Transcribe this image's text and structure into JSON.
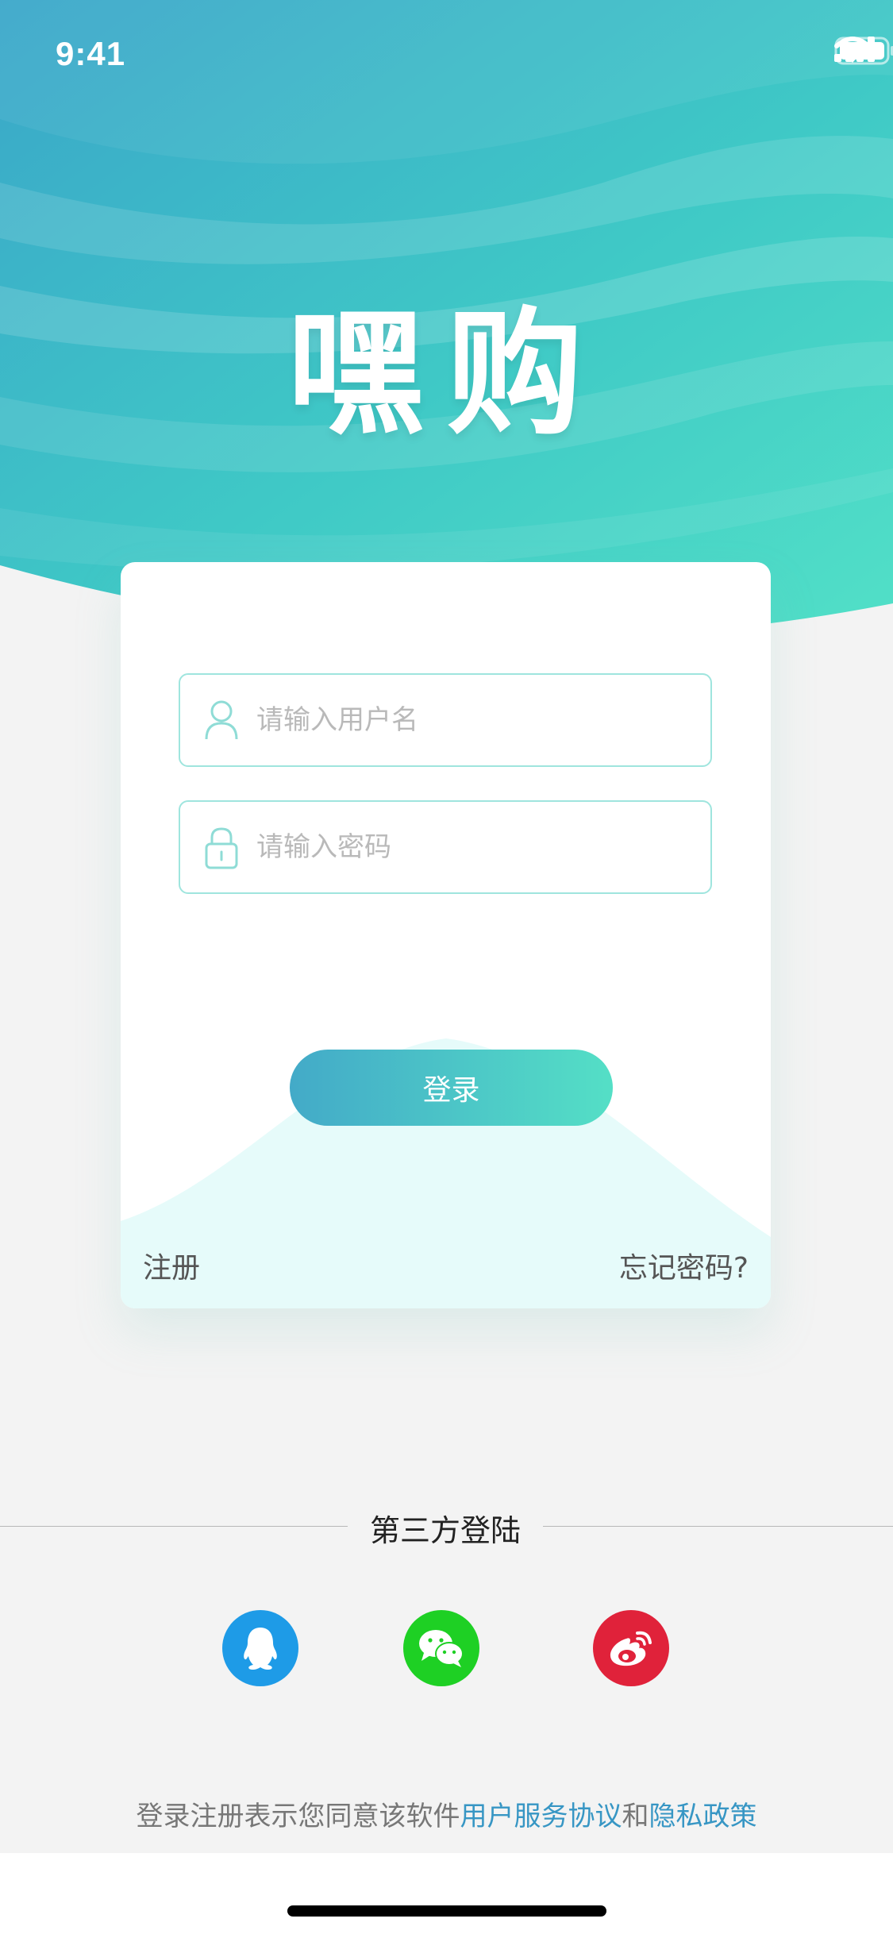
{
  "status_bar": {
    "time": "9:41"
  },
  "app": {
    "logo_text": "嘿购"
  },
  "login_form": {
    "username_placeholder": "请输入用户名",
    "password_placeholder": "请输入密码",
    "login_label": "登录",
    "register_label": "注册",
    "forgot_label": "忘记密码?"
  },
  "third_party": {
    "title": "第三方登陆",
    "providers": [
      {
        "name": "QQ",
        "icon": "qq-penguin-icon",
        "color": "#1e9be7"
      },
      {
        "name": "WeChat",
        "icon": "wechat-icon",
        "color": "#1ed024"
      },
      {
        "name": "Weibo",
        "icon": "weibo-icon",
        "color": "#e0223a"
      }
    ]
  },
  "agreement": {
    "prefix": "登录注册表示您同意该软件",
    "terms_link": "用户服务协议",
    "conjunction": "和",
    "privacy_link": "隐私政策"
  },
  "colors": {
    "gradient_start": "#43aac8",
    "gradient_end": "#54dfc6",
    "link": "#3796c4",
    "background": "#f3f3f3"
  }
}
